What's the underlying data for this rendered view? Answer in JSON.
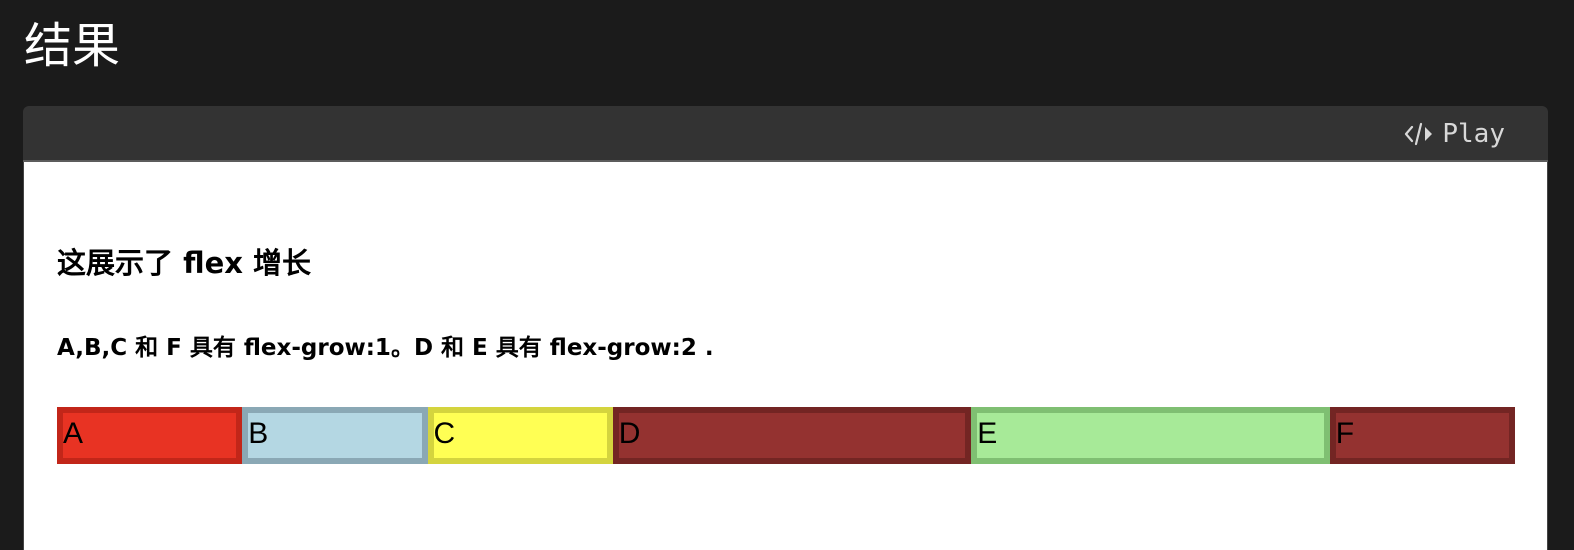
{
  "page": {
    "title": "结果"
  },
  "toolbar": {
    "play_label": "Play",
    "play_icon": "code-icon"
  },
  "demo": {
    "heading": "这展示了 flex 增长",
    "description": "A,B,C 和 F 具有 flex-grow:1。D 和 E 具有 flex-grow:2 .",
    "items": [
      {
        "label": "A",
        "grow": 1,
        "fill": "#e83323",
        "border": "#c22619"
      },
      {
        "label": "B",
        "grow": 1,
        "fill": "#b4d7e3",
        "border": "#8aa8b5"
      },
      {
        "label": "C",
        "grow": 1,
        "fill": "#ffff54",
        "border": "#d4d43e"
      },
      {
        "label": "D",
        "grow": 2,
        "fill": "#943230",
        "border": "#732523"
      },
      {
        "label": "E",
        "grow": 2,
        "fill": "#a7ea98",
        "border": "#7fbf72"
      },
      {
        "label": "F",
        "grow": 1,
        "fill": "#943230",
        "border": "#732523"
      }
    ]
  }
}
